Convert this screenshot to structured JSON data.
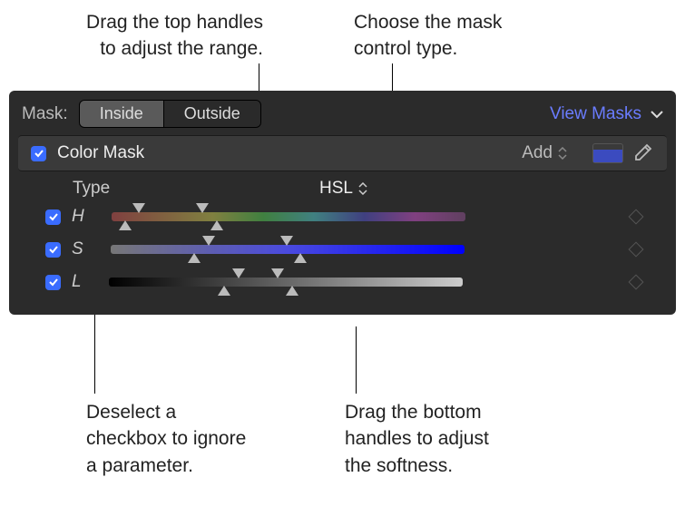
{
  "callouts": {
    "top_left": "Drag the top handles\nto adjust the range.",
    "top_right": "Choose the mask\ncontrol type.",
    "bottom_left": "Deselect a\ncheckbox to ignore\na parameter.",
    "bottom_right": "Drag the bottom\nhandles to adjust\nthe softness."
  },
  "header": {
    "mask_label": "Mask:",
    "seg_inside": "Inside",
    "seg_outside": "Outside",
    "view_masks": "View Masks"
  },
  "section": {
    "title": "Color Mask",
    "add_label": "Add",
    "swatch_color": "#3b4bbf"
  },
  "type_row": {
    "label": "Type",
    "value": "HSL"
  },
  "params": {
    "h": {
      "label": "H",
      "checked": true,
      "top_handles": [
        6,
        24
      ],
      "bot_handles": [
        2,
        28
      ]
    },
    "s": {
      "label": "S",
      "checked": true,
      "top_handles": [
        26,
        48
      ],
      "bot_handles": [
        22,
        52
      ]
    },
    "l": {
      "label": "L",
      "checked": true,
      "top_handles": [
        35,
        46
      ],
      "bot_handles": [
        31,
        50
      ]
    }
  }
}
